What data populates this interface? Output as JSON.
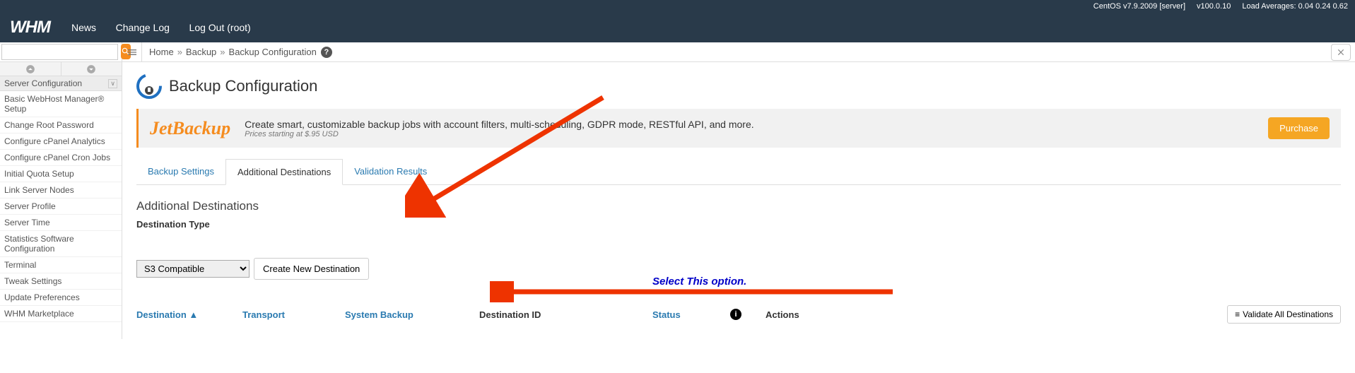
{
  "status": {
    "os": "CentOS v7.9.2009 [server]",
    "version": "v100.0.10",
    "load_label": "Load Averages: 0.04 0.24 0.62"
  },
  "nav": {
    "logo": "WHM",
    "links": [
      "News",
      "Change Log",
      "Log Out (root)"
    ]
  },
  "breadcrumb": {
    "items": [
      "Home",
      "Backup",
      "Backup Configuration"
    ]
  },
  "sidebar": {
    "section": "Server Configuration",
    "items": [
      "Basic WebHost Manager® Setup",
      "Change Root Password",
      "Configure cPanel Analytics",
      "Configure cPanel Cron Jobs",
      "Initial Quota Setup",
      "Link Server Nodes",
      "Server Profile",
      "Server Time",
      "Statistics Software Configuration",
      "Terminal",
      "Tweak Settings",
      "Update Preferences",
      "WHM Marketplace"
    ]
  },
  "page": {
    "title": "Backup Configuration"
  },
  "promo": {
    "brand": "JetBackup",
    "line1": "Create smart, customizable backup jobs with account filters, multi-scheduling, GDPR mode, RESTful API, and more.",
    "line2": "Prices starting at $.95 USD",
    "cta": "Purchase"
  },
  "tabs": {
    "settings": "Backup Settings",
    "destinations": "Additional Destinations",
    "validation": "Validation Results"
  },
  "content": {
    "section_title": "Additional Destinations",
    "dest_type_label": "Destination Type",
    "select_value": "S3 Compatible",
    "create_label": "Create New Destination",
    "annotation": "Select This option.",
    "columns": {
      "destination": "Destination ▲",
      "transport": "Transport",
      "system_backup": "System Backup",
      "destination_id": "Destination ID",
      "status": "Status",
      "actions": "Actions"
    },
    "validate_all": "Validate All Destinations"
  }
}
